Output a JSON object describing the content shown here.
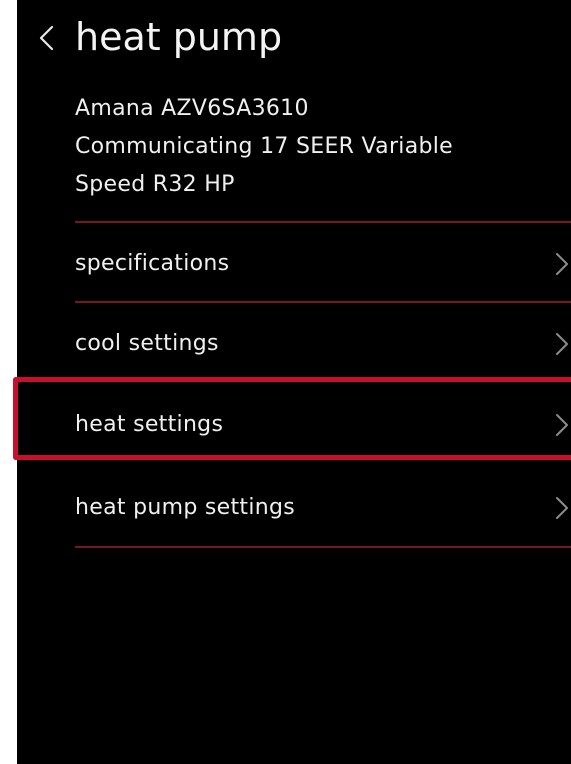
{
  "header": {
    "title": "heat pump",
    "back_icon": "chevron-left-icon"
  },
  "device": {
    "name_lines": [
      "Amana AZV6SA3610",
      "Communicating 17 SEER Variable",
      "Speed R32 HP"
    ]
  },
  "menu": {
    "items": [
      {
        "label": "specifications",
        "icon": "chevron-right-icon"
      },
      {
        "label": "cool settings",
        "icon": "chevron-right-icon"
      },
      {
        "label": "heat settings",
        "icon": "chevron-right-icon",
        "highlighted": true
      },
      {
        "label": "heat pump settings",
        "icon": "chevron-right-icon"
      }
    ]
  },
  "colors": {
    "background": "#000000",
    "text": "#f0f0f0",
    "divider": "#7a1620",
    "highlight": "#c8102e",
    "chevron": "#8c8c8c"
  }
}
